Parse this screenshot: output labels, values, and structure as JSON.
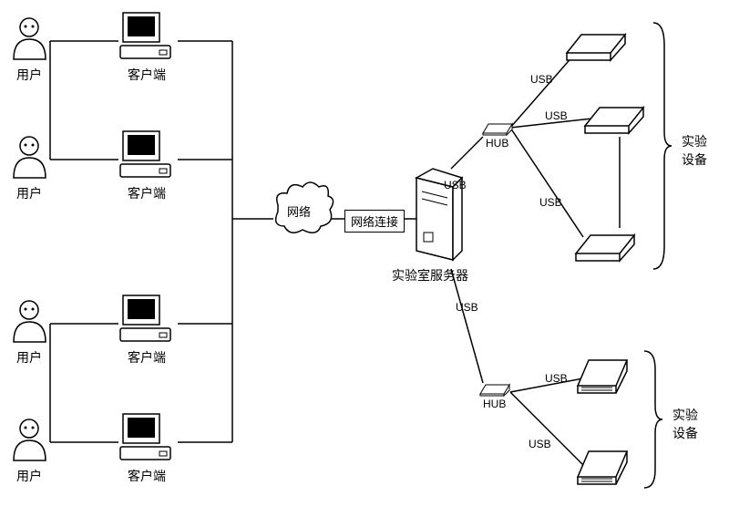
{
  "users": [
    "用户",
    "用户",
    "用户",
    "用户"
  ],
  "clients": [
    "客户端",
    "客户端",
    "客户端",
    "客户端"
  ],
  "cloud": "网络",
  "linkBox": "网络连接",
  "server": "实验室服务器",
  "hub1": "HUB",
  "hub2": "HUB",
  "usb": [
    "USB",
    "USB",
    "USB",
    "USB",
    "USB",
    "USB",
    "USB"
  ],
  "equipGroup1": "实验\n设备",
  "equipGroup2": "实验\n设备"
}
